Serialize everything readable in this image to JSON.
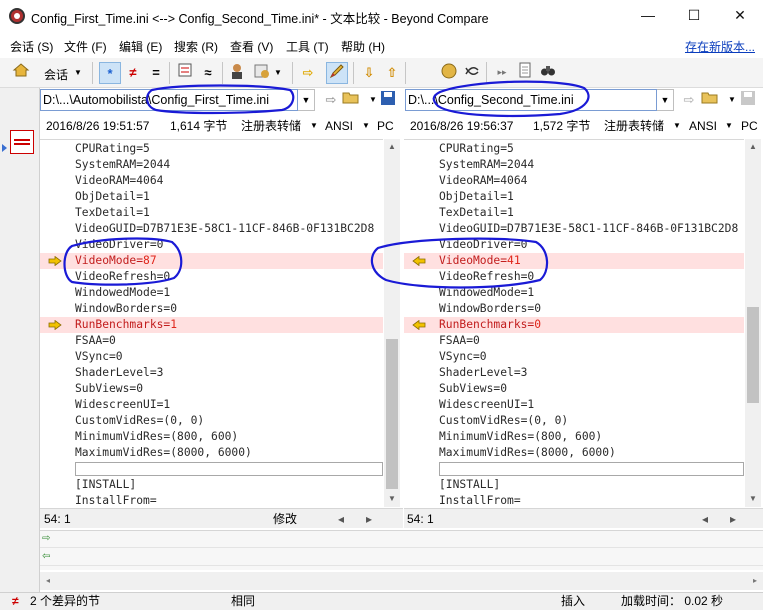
{
  "window": {
    "title": "Config_First_Time.ini <--> Config_Second_Time.ini* - 文本比较 - Beyond Compare",
    "minimize": "—",
    "maximize": "☐",
    "close": "✕"
  },
  "menu": {
    "items": [
      "会话 (S)",
      "文件 (F)",
      "编辑 (E)",
      "搜索 (R)",
      "查看 (V)",
      "工具 (T)",
      "帮助 (H)"
    ],
    "update_link": "存在新版本..."
  },
  "toolbar": {
    "session_label": "会话",
    "icons": [
      "home-icon",
      "all-icon",
      "diffs-icon",
      "same-icon",
      "context-icon",
      "minor-icon",
      "rules-icon",
      "format-icon",
      "copy-right-icon",
      "edit-icon",
      "next-diff-icon",
      "prev-diff-icon",
      "swap-icon",
      "refresh-icon",
      "binoculars-icon"
    ]
  },
  "left": {
    "path_prefix": "D:\\...\\Automobilista\\",
    "path_file": "Config_First_Time.ini",
    "datetime": "2016/8/26 19:51:57",
    "size": "1,614 字节",
    "converter": "注册表转储",
    "encoding": "ANSI",
    "line_ending": "PC",
    "cursor_pos": "54: 1",
    "mode": "修改",
    "lines": [
      {
        "text": "CPURating=5"
      },
      {
        "text": "SystemRAM=2044"
      },
      {
        "text": "VideoRAM=4064"
      },
      {
        "text": "ObjDetail=1"
      },
      {
        "text": "TexDetail=1"
      },
      {
        "text": "VideoGUID=D7B71E3E-58C1-11CF-846B-0F131BC2D8"
      },
      {
        "text": "VideoDriver=0"
      },
      {
        "text": "VideoMode=",
        "changed": "87",
        "diff": true
      },
      {
        "text": "VideoRefresh=0"
      },
      {
        "text": "WindowedMode=1"
      },
      {
        "text": "WindowBorders=0"
      },
      {
        "text": "RunBenchmarks=",
        "changed": "1",
        "diff": true
      },
      {
        "text": "FSAA=0"
      },
      {
        "text": "VSync=0"
      },
      {
        "text": "ShaderLevel=3"
      },
      {
        "text": "SubViews=0"
      },
      {
        "text": "WidescreenUI=1"
      },
      {
        "text": "CustomVidRes=(0, 0)"
      },
      {
        "text": "MinimumVidRes=(800, 600)"
      },
      {
        "text": "MaximumVidRes=(8000, 6000)"
      },
      {
        "text": "",
        "separator": true
      },
      {
        "text": "[INSTALL]"
      },
      {
        "text": "InstallFrom="
      }
    ]
  },
  "right": {
    "path_prefix": "D:\\...\\",
    "path_file": "Config_Second_Time.ini",
    "datetime": "2016/8/26 19:56:37",
    "size": "1,572 字节",
    "converter": "注册表转储",
    "encoding": "ANSI",
    "line_ending": "PC",
    "cursor_pos": "54: 1",
    "lines": [
      {
        "text": "CPURating=5"
      },
      {
        "text": "SystemRAM=2044"
      },
      {
        "text": "VideoRAM=4064"
      },
      {
        "text": "ObjDetail=1"
      },
      {
        "text": "TexDetail=1"
      },
      {
        "text": "VideoGUID=D7B71E3E-58C1-11CF-846B-0F131BC2D8"
      },
      {
        "text": "VideoDriver=0"
      },
      {
        "text": "VideoMode=",
        "changed": "41",
        "diff": true
      },
      {
        "text": "VideoRefresh=0"
      },
      {
        "text": "WindowedMode=1"
      },
      {
        "text": "WindowBorders=0"
      },
      {
        "text": "RunBenchmarks=",
        "changed": "0",
        "diff": true
      },
      {
        "text": "FSAA=0"
      },
      {
        "text": "VSync=0"
      },
      {
        "text": "ShaderLevel=3"
      },
      {
        "text": "SubViews=0"
      },
      {
        "text": "WidescreenUI=1"
      },
      {
        "text": "CustomVidRes=(0, 0)"
      },
      {
        "text": "MinimumVidRes=(800, 600)"
      },
      {
        "text": "MaximumVidRes=(8000, 6000)"
      },
      {
        "text": "",
        "separator": true
      },
      {
        "text": "[INSTALL]"
      },
      {
        "text": "InstallFrom="
      }
    ]
  },
  "status": {
    "diff_icon": "≠",
    "diff_count": "2 个差异的节",
    "compare_state": "相同",
    "insert_mode": "插入",
    "load_time": "加载时间： 0.02 秒"
  },
  "colors": {
    "diff_bg": "#ffe0e0",
    "diff_text": "#c21d1d",
    "ink": "#1a1ad6",
    "arrow": "#e0a800"
  }
}
